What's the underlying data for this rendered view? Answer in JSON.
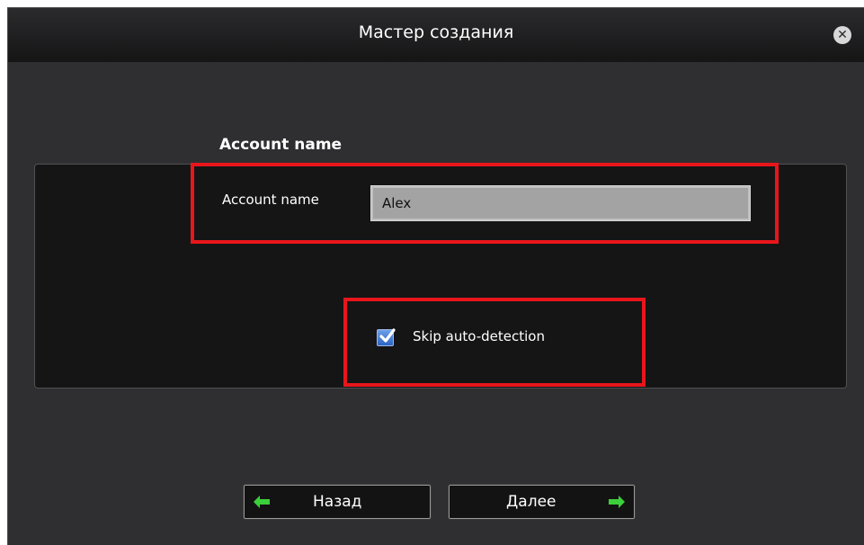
{
  "window": {
    "title": "Мастер создания"
  },
  "section": {
    "title": "Account name"
  },
  "account": {
    "label": "Account name",
    "value": "Alex"
  },
  "skip": {
    "label": "Skip auto-detection",
    "checked": true
  },
  "buttons": {
    "back_label": "Назад",
    "next_label": "Далее"
  },
  "icons": {
    "close": "close-icon",
    "back": "arrow-left-icon",
    "next": "arrow-right-icon",
    "check": "check-icon"
  },
  "colors": {
    "highlight": "#e8161b",
    "arrow": "#3ccf3c",
    "checkbox": "#2c64c4"
  }
}
